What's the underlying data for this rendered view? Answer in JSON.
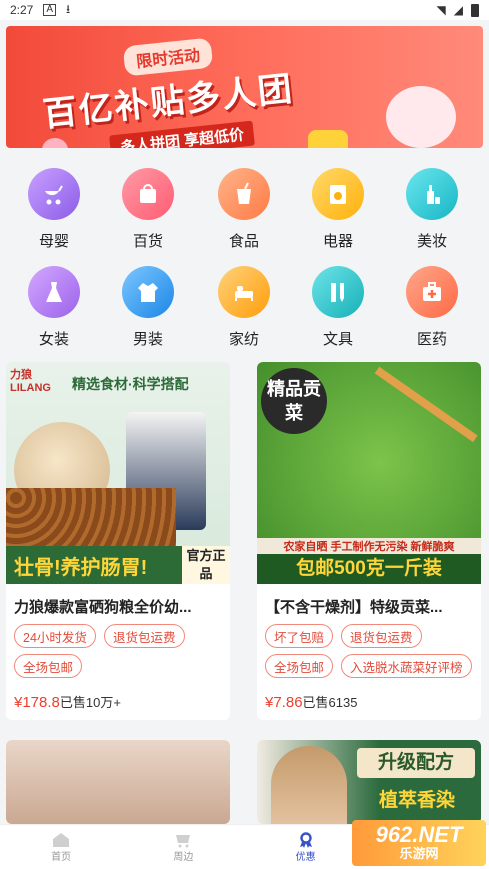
{
  "status_bar": {
    "time": "2:27"
  },
  "banner": {
    "tag": "限时活动",
    "headline": "百亿补贴多人团",
    "subline": "多人拼团 享超低价"
  },
  "categories": [
    {
      "label": "母婴",
      "icon": "stroller-icon",
      "color": "#a873f0"
    },
    {
      "label": "百货",
      "icon": "shopping-bag-icon",
      "color": "#ff6b7a"
    },
    {
      "label": "食品",
      "icon": "drink-cup-icon",
      "color": "#ff8c5a"
    },
    {
      "label": "电器",
      "icon": "washing-machine-icon",
      "color": "#ffc02a"
    },
    {
      "label": "美妆",
      "icon": "cosmetics-icon",
      "color": "#2fcad6"
    },
    {
      "label": "女装",
      "icon": "dress-icon",
      "color": "#b47ef0"
    },
    {
      "label": "男装",
      "icon": "shirt-icon",
      "color": "#3aa4f0"
    },
    {
      "label": "家纺",
      "icon": "bed-icon",
      "color": "#ffb02a"
    },
    {
      "label": "文具",
      "icon": "ruler-pen-icon",
      "color": "#2ec4c9"
    },
    {
      "label": "医药",
      "icon": "medical-kit-icon",
      "color": "#ff7a5a"
    }
  ],
  "products": [
    {
      "img_brand": "力狼 LILANG",
      "img_headline": "精选食材·科学搭配",
      "img_bottom": "壮骨!养护肠胃!",
      "img_badge": "官方正品",
      "title": "力狼爆款富硒狗粮全价幼...",
      "tags": [
        "24小时发货",
        "退货包运费",
        "全场包邮"
      ],
      "price": "¥178.8",
      "sold": "已售10万+"
    },
    {
      "img_headline": "精品贡菜",
      "img_line1": "农家自晒 手工制作无污染 新鲜脆爽",
      "img_bottom": "包邮500克一斤装",
      "title": "【不含干燥剂】特级贡菜...",
      "tags": [
        "坏了包赔",
        "退货包运费",
        "全场包邮",
        "入选脱水蔬菜好评榜"
      ],
      "price": "¥7.86",
      "sold": "已售6135"
    },
    {
      "img_headline": "升级配方",
      "img_line1": "植萃香染"
    }
  ],
  "tabbar": [
    {
      "label": "首页",
      "icon": "home-icon"
    },
    {
      "label": "周边",
      "icon": "nearby-icon"
    },
    {
      "label": "优惠",
      "icon": "coupon-icon"
    }
  ],
  "watermark": {
    "text": "962.NET",
    "sub": "乐游网"
  }
}
